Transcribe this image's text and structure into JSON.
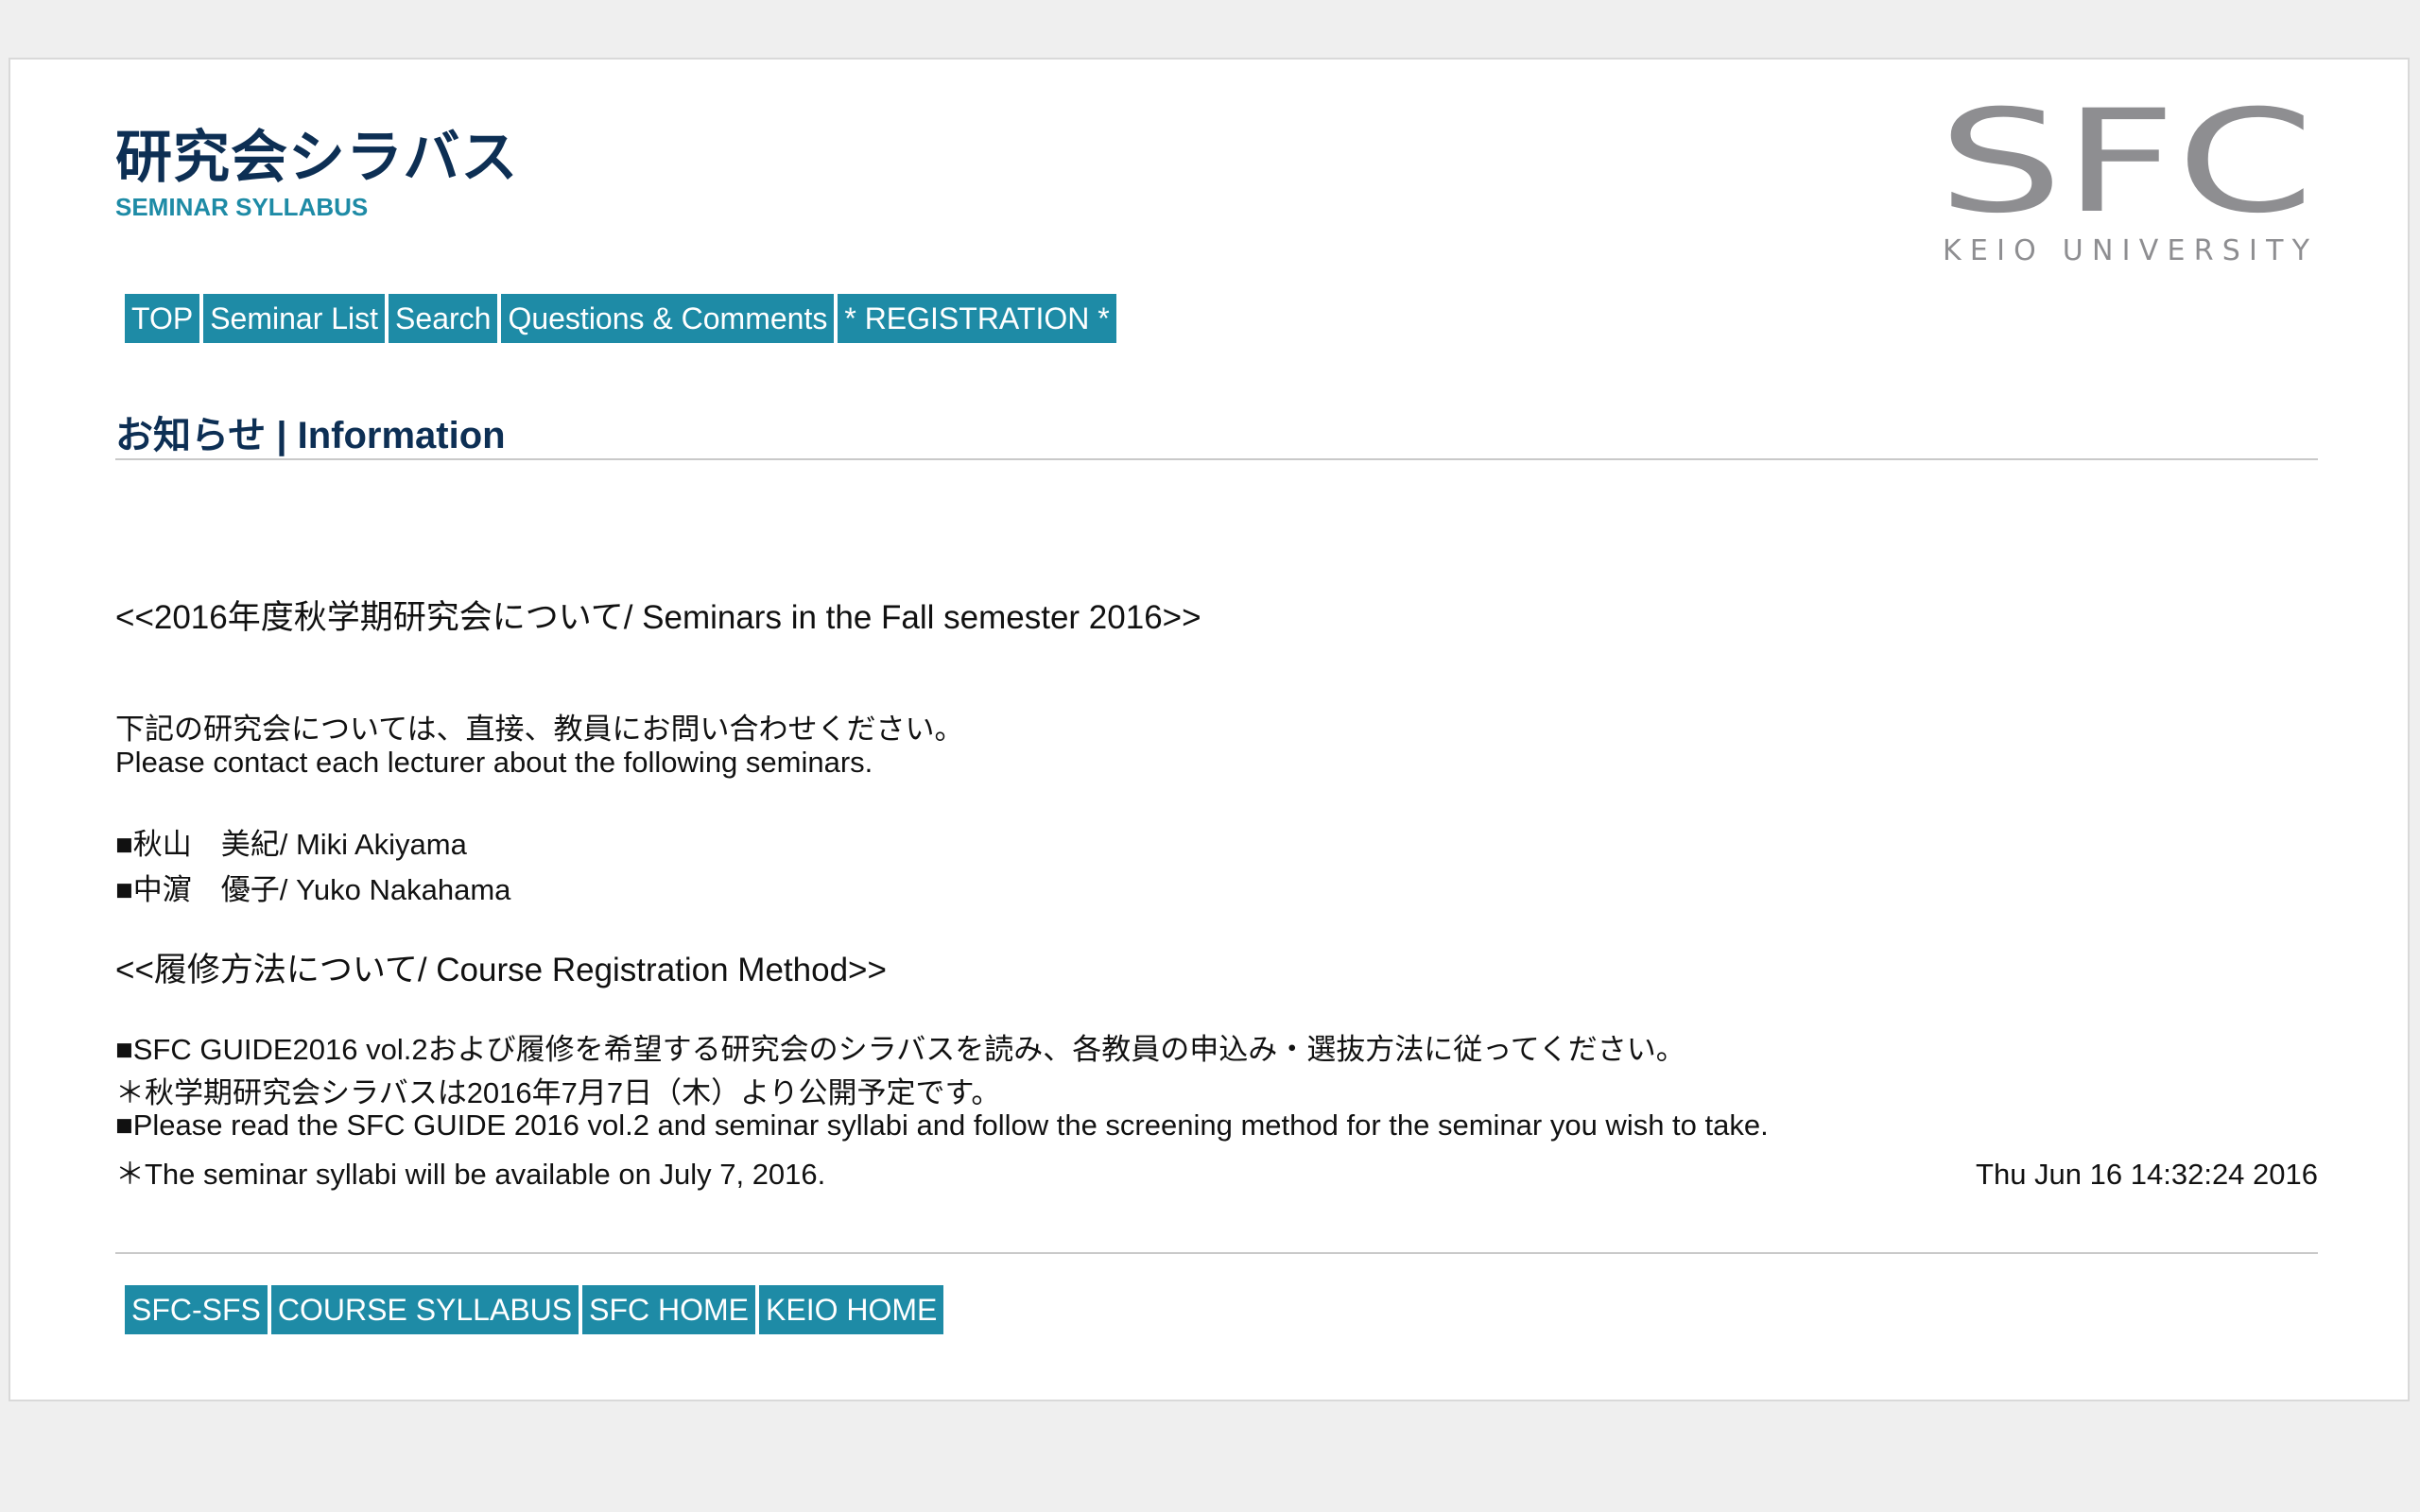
{
  "header": {
    "title_ja": "研究会シラバス",
    "title_en": "SEMINAR SYLLABUS",
    "logo": {
      "main_text": "SFC",
      "sub_text": "KEIO UNIVERSITY",
      "color": "#8e8e91"
    }
  },
  "nav": {
    "items": [
      {
        "label": "TOP"
      },
      {
        "label": "Seminar List"
      },
      {
        "label": "Search"
      },
      {
        "label": "Questions & Comments"
      },
      {
        "label": "* REGISTRATION *"
      }
    ]
  },
  "info": {
    "heading": "お知らせ | Information",
    "fall_title": "<<2016年度秋学期研究会について/ Seminars in the Fall semester 2016>>",
    "contact_ja": "下記の研究会については、直接、教員にお問い合わせください。",
    "contact_en": "Please contact each lecturer about the following seminars.",
    "lecturers": [
      "■秋山　美紀/ Miki Akiyama",
      "■中濵　優子/ Yuko Nakahama"
    ],
    "method_title": "<<履修方法について/ Course Registration Method>>",
    "method_lines": [
      "■SFC GUIDE2016 vol.2および履修を希望する研究会のシラバスを読み、各教員の申込み・選抜方法に従ってください。",
      "＊秋学期研究会シラバスは2016年7月7日（木）より公開予定です。",
      "■Please read the SFC GUIDE 2016 vol.2 and seminar syllabi and follow the screening method for the seminar you wish to take.",
      "＊The seminar syllabi will be available on July 7, 2016."
    ],
    "timestamp": "Thu Jun 16 14:32:24 2016"
  },
  "footer": {
    "items": [
      {
        "label": "SFC-SFS"
      },
      {
        "label": "COURSE SYLLABUS"
      },
      {
        "label": "SFC HOME"
      },
      {
        "label": "KEIO HOME"
      }
    ]
  },
  "colors": {
    "accent": "#1e8ba6",
    "heading": "#0d2f54",
    "background": "#efefef",
    "panel": "#ffffff"
  }
}
